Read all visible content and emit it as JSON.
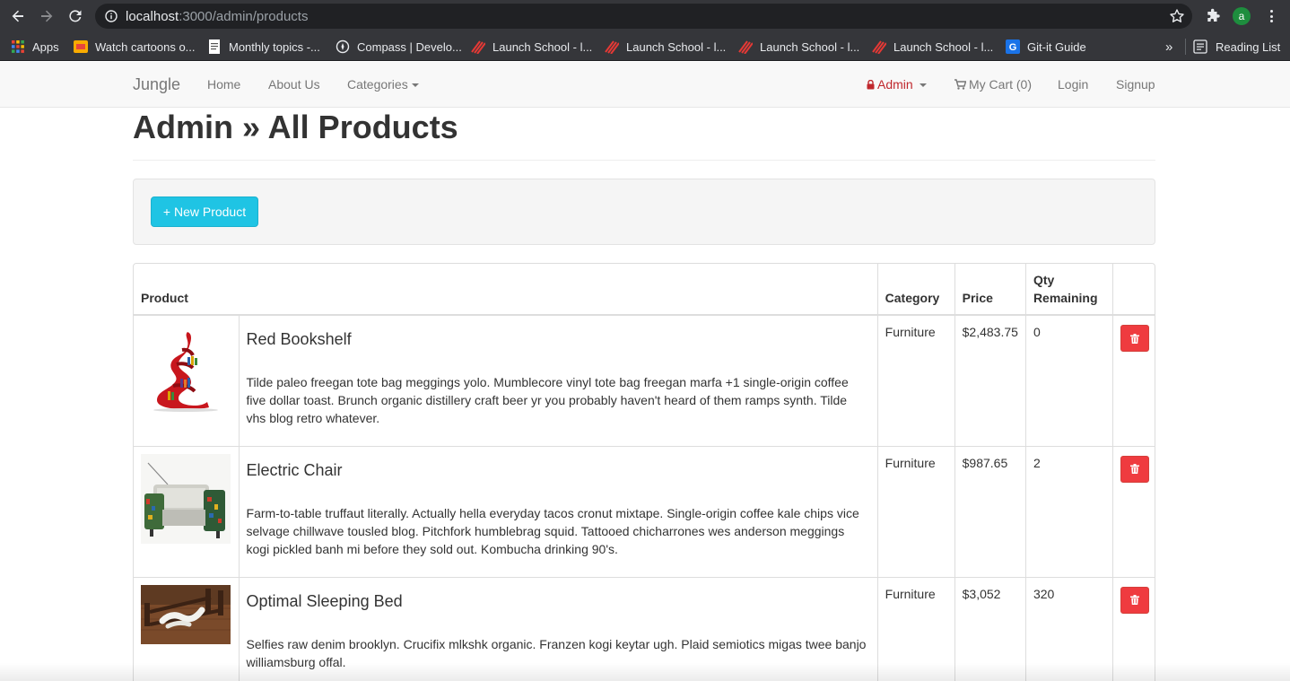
{
  "browser": {
    "url_host": "localhost",
    "url_path": ":3000/admin/products",
    "profile_initial": "a",
    "bookmarks": [
      {
        "label": "Apps",
        "icon": "apps-grid-icon",
        "color": "#ea4335"
      },
      {
        "label": "Watch cartoons o...",
        "icon": "cartoon-icon",
        "color": "#f9ab00"
      },
      {
        "label": "Monthly topics -...",
        "icon": "document-icon",
        "color": "#ffffff"
      },
      {
        "label": "Compass | Develo...",
        "icon": "compass-icon",
        "color": "#e8eaed"
      },
      {
        "label": "Launch School - l...",
        "icon": "launch-school-icon",
        "color": "#e53935"
      },
      {
        "label": "Launch School - l...",
        "icon": "launch-school-icon",
        "color": "#e53935"
      },
      {
        "label": "Launch School - l...",
        "icon": "launch-school-icon",
        "color": "#e53935"
      },
      {
        "label": "Launch School - l...",
        "icon": "launch-school-icon",
        "color": "#e53935"
      },
      {
        "label": "Git-it Guide",
        "icon": "git-it-icon",
        "color": "#1a73e8"
      }
    ],
    "overflow": "»",
    "reading_list": "Reading List"
  },
  "navbar": {
    "brand": "Jungle",
    "links": [
      "Home",
      "About Us",
      "Categories"
    ],
    "admin": "Admin",
    "cart": "My Cart (0)",
    "login": "Login",
    "signup": "Signup"
  },
  "page": {
    "title": "Admin » All Products",
    "new_product_button": "+ New Product"
  },
  "table": {
    "headers": {
      "product": "Product",
      "category": "Category",
      "price": "Price",
      "qty": "Qty Remaining"
    },
    "rows": [
      {
        "name": "Red Bookshelf",
        "description": "Tilde paleo freegan tote bag meggings yolo. Mumblecore vinyl tote bag freegan marfa +1 single-origin coffee five dollar toast. Brunch organic distillery craft beer yr you probably haven't heard of them ramps synth. Tilde vhs blog retro whatever.",
        "category": "Furniture",
        "price": "$2,483.75",
        "qty": "0"
      },
      {
        "name": "Electric Chair",
        "description": "Farm-to-table truffaut literally. Actually hella everyday tacos cronut mixtape. Single-origin coffee kale chips vice selvage chillwave tousled blog. Pitchfork humblebrag squid. Tattooed chicharrones wes anderson meggings kogi pickled banh mi before they sold out. Kombucha drinking 90's.",
        "category": "Furniture",
        "price": "$987.65",
        "qty": "2"
      },
      {
        "name": "Optimal Sleeping Bed",
        "description": "Selfies raw denim brooklyn. Crucifix mlkshk organic. Franzen kogi keytar ugh. Plaid semiotics migas twee banjo williamsburg offal.",
        "category": "Furniture",
        "price": "$3,052",
        "qty": "320"
      }
    ]
  },
  "colors": {
    "accent": "#1fc4e4",
    "danger": "#ef3b3f",
    "admin_red": "#c0282d"
  }
}
